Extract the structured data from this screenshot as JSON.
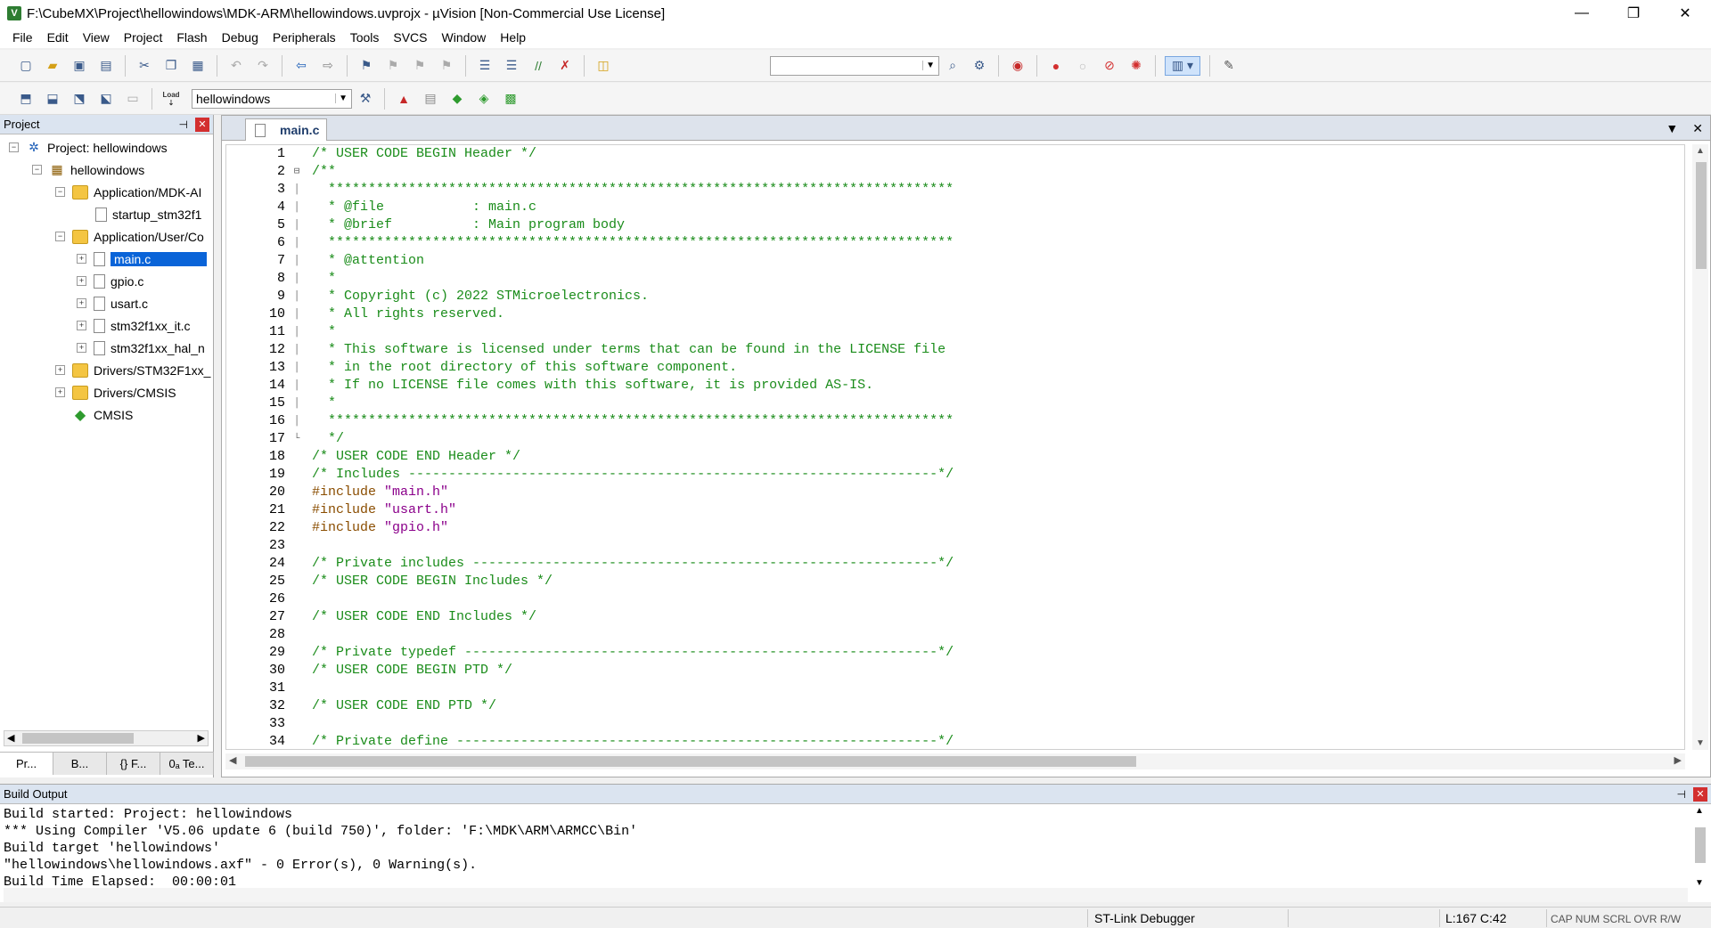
{
  "window": {
    "title": "F:\\CubeMX\\Project\\hellowindows\\MDK-ARM\\hellowindows.uvprojx - µVision  [Non-Commercial Use License]",
    "app_icon": "V",
    "min_glyph": "—",
    "max_glyph": "❐",
    "close_glyph": "✕"
  },
  "menu": [
    "File",
    "Edit",
    "View",
    "Project",
    "Flash",
    "Debug",
    "Peripherals",
    "Tools",
    "SVCS",
    "Window",
    "Help"
  ],
  "toolbar1": {
    "icons": [
      "new-file-icon",
      "open-icon",
      "save-icon",
      "save-all-icon",
      "cut-icon",
      "copy-icon",
      "paste-icon",
      "undo-icon",
      "redo-icon",
      "nav-back-icon",
      "nav-forward-icon",
      "bookmark-icon",
      "bookmark-prev-icon",
      "bookmark-next-icon",
      "bookmark-clear-icon",
      "indent-icon",
      "unindent-icon",
      "comment-icon",
      "uncomment-icon",
      "find-in-files-icon",
      "find-icon",
      "incremental-find-icon",
      "debug-start-icon",
      "breakpoint-icon",
      "breakpoint-disable-icon",
      "breakpoint-kill-icon",
      "breakpoint-all-icon",
      "window-layout-icon",
      "configure-icon"
    ]
  },
  "toolbar2": {
    "target_value": "hellowindows",
    "load_label": "Load",
    "icons": [
      "translate-icon",
      "build-icon",
      "rebuild-icon",
      "batch-build-icon",
      "stop-build-icon",
      "download-icon",
      "target-options-icon",
      "manage-components-icon",
      "select-pack-icon",
      "pack-installer-icon",
      "run-time-env-icon"
    ]
  },
  "project_panel": {
    "title": "Project",
    "pin_glyph": "⊣",
    "close_glyph": "✕",
    "tree": [
      {
        "label": "Project: hellowindows",
        "expander": "−"
      },
      {
        "label": "hellowindows",
        "expander": "−"
      },
      {
        "label": "Application/MDK-AI",
        "expander": "−"
      },
      {
        "label": "startup_stm32f1",
        "expander": ""
      },
      {
        "label": "Application/User/Co",
        "expander": "−"
      },
      {
        "label": "main.c",
        "expander": "+"
      },
      {
        "label": "gpio.c",
        "expander": "+"
      },
      {
        "label": "usart.c",
        "expander": "+"
      },
      {
        "label": "stm32f1xx_it.c",
        "expander": "+"
      },
      {
        "label": "stm32f1xx_hal_n",
        "expander": "+"
      },
      {
        "label": "Drivers/STM32F1xx_",
        "expander": "+"
      },
      {
        "label": "Drivers/CMSIS",
        "expander": "+"
      },
      {
        "label": "CMSIS",
        "expander": ""
      }
    ],
    "tabs": [
      "Pr...",
      "B...",
      "{} F...",
      "0ₐ Te..."
    ]
  },
  "editor": {
    "tab_label": "main.c",
    "menu_glyph": "▼",
    "close_glyph": "✕",
    "lines": [
      {
        "n": "1",
        "t": "/* USER CODE BEGIN Header */"
      },
      {
        "n": "2",
        "t": "/**"
      },
      {
        "n": "3",
        "t": "  ******************************************************************************"
      },
      {
        "n": "4",
        "t": "  * @file           : main.c"
      },
      {
        "n": "5",
        "t": "  * @brief          : Main program body"
      },
      {
        "n": "6",
        "t": "  ******************************************************************************"
      },
      {
        "n": "7",
        "t": "  * @attention"
      },
      {
        "n": "8",
        "t": "  *"
      },
      {
        "n": "9",
        "t": "  * Copyright (c) 2022 STMicroelectronics."
      },
      {
        "n": "10",
        "t": "  * All rights reserved."
      },
      {
        "n": "11",
        "t": "  *"
      },
      {
        "n": "12",
        "t": "  * This software is licensed under terms that can be found in the LICENSE file"
      },
      {
        "n": "13",
        "t": "  * in the root directory of this software component."
      },
      {
        "n": "14",
        "t": "  * If no LICENSE file comes with this software, it is provided AS-IS."
      },
      {
        "n": "15",
        "t": "  *"
      },
      {
        "n": "16",
        "t": "  ******************************************************************************"
      },
      {
        "n": "17",
        "t": "  */"
      },
      {
        "n": "18",
        "t": "/* USER CODE END Header */"
      },
      {
        "n": "19",
        "t": "/* Includes ------------------------------------------------------------------*/"
      },
      {
        "n": "20",
        "t": "#include \"main.h\""
      },
      {
        "n": "21",
        "t": "#include \"usart.h\""
      },
      {
        "n": "22",
        "t": "#include \"gpio.h\""
      },
      {
        "n": "23",
        "t": ""
      },
      {
        "n": "24",
        "t": "/* Private includes ----------------------------------------------------------*/"
      },
      {
        "n": "25",
        "t": "/* USER CODE BEGIN Includes */"
      },
      {
        "n": "26",
        "t": ""
      },
      {
        "n": "27",
        "t": "/* USER CODE END Includes */"
      },
      {
        "n": "28",
        "t": ""
      },
      {
        "n": "29",
        "t": "/* Private typedef -----------------------------------------------------------*/"
      },
      {
        "n": "30",
        "t": "/* USER CODE BEGIN PTD */"
      },
      {
        "n": "31",
        "t": ""
      },
      {
        "n": "32",
        "t": "/* USER CODE END PTD */"
      },
      {
        "n": "33",
        "t": ""
      },
      {
        "n": "34",
        "t": "/* Private define ------------------------------------------------------------*/"
      }
    ]
  },
  "build_output": {
    "title": "Build Output",
    "lines": [
      "Build started: Project: hellowindows",
      "*** Using Compiler 'V5.06 update 6 (build 750)', folder: 'F:\\MDK\\ARM\\ARMCC\\Bin'",
      "Build target 'hellowindows'",
      "\"hellowindows\\hellowindows.axf\" - 0 Error(s), 0 Warning(s).",
      "Build Time Elapsed:  00:00:01"
    ]
  },
  "statusbar": {
    "debugger": "ST-Link Debugger",
    "position": "L:167 C:42",
    "flags": "CAP  NUM  SCRL  OVR  R/W"
  },
  "colors": {
    "comment": "#1a8c1a",
    "preprocessor": "#8a4d00",
    "string": "#8b008b",
    "selection": "#0a64d8"
  }
}
